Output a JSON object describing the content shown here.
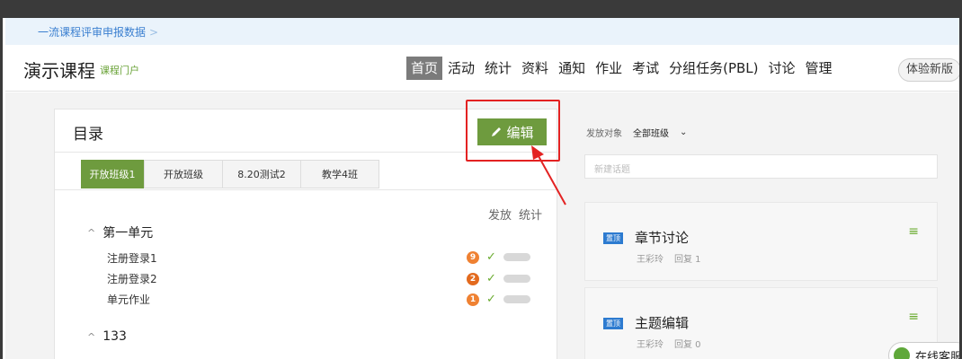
{
  "breadcrumb": {
    "text": "一流课程评审申报数据",
    "chevron": ">"
  },
  "header": {
    "course_title": "演示课程",
    "portal_link": "课程门户",
    "nav": [
      "首页",
      "活动",
      "统计",
      "资料",
      "通知",
      "作业",
      "考试",
      "分组任务(PBL)",
      "讨论",
      "管理"
    ],
    "active_nav": "首页",
    "new_version": "体验新版"
  },
  "catalog": {
    "title": "目录",
    "edit_button": "编辑",
    "tabs": [
      "开放班级1",
      "开放班级",
      "8.20测试2",
      "教学4班"
    ],
    "col_release": "发放",
    "col_stats": "统计",
    "units": [
      {
        "name": "第一单元",
        "chapters": [
          {
            "name": "注册登录1",
            "badge": "9"
          },
          {
            "name": "注册登录2",
            "badge": "2"
          },
          {
            "name": "单元作业",
            "badge": "1"
          }
        ]
      },
      {
        "name": "133",
        "chapters": []
      }
    ]
  },
  "discussion": {
    "audience_label": "发放对象",
    "audience_value": "全部班级",
    "topic_placeholder": "新建话题",
    "posts": [
      {
        "pin": "置顶",
        "title": "章节讨论",
        "author": "王彩玲",
        "reply": "回复 1"
      },
      {
        "pin": "置顶",
        "title": "主题编辑",
        "author": "王彩玲",
        "reply": "回复 0"
      }
    ]
  },
  "chat_widget": {
    "label": "在线客服"
  },
  "colors": {
    "accent_green": "#6e9b3e",
    "highlight_red": "#e32222",
    "badge_orange": "#ef8132",
    "link_blue": "#3a7fd0"
  }
}
